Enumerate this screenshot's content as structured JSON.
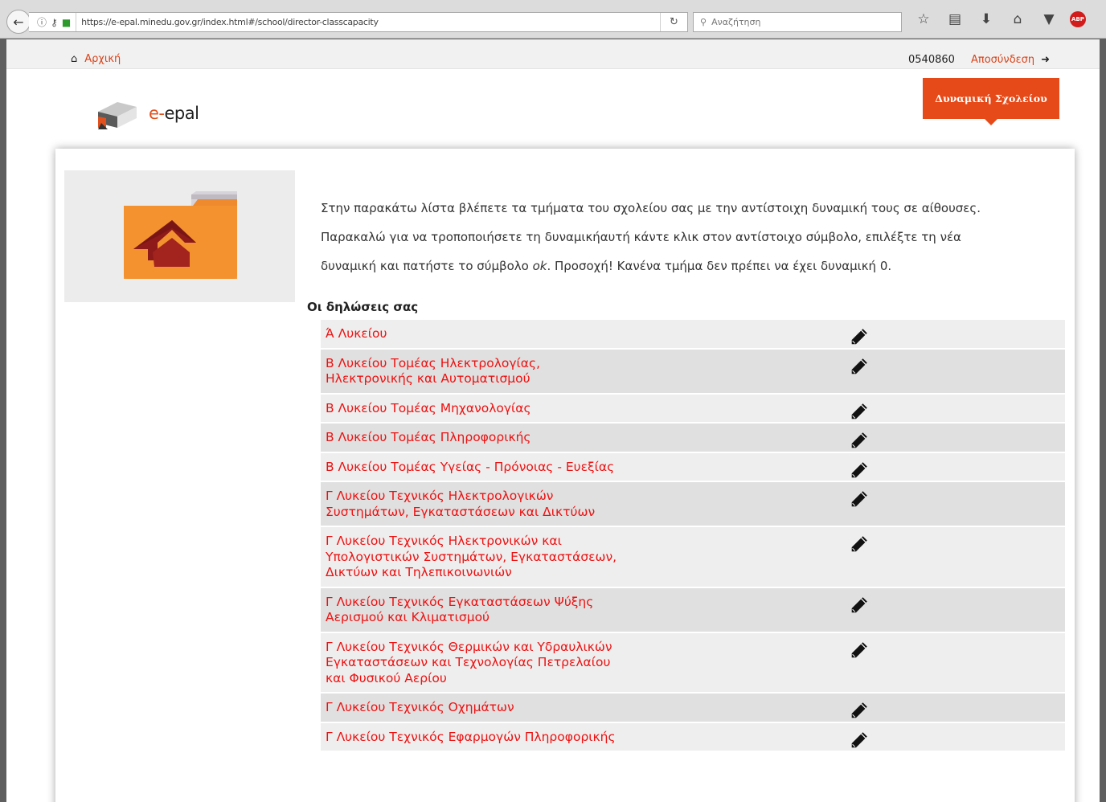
{
  "browser": {
    "url": "https://e-epal.minedu.gov.gr/index.html#/school/director-classcapacity",
    "search_placeholder": "Αναζήτηση"
  },
  "topnav": {
    "home_label": "Αρχική",
    "user_code": "0540860",
    "logout_label": "Αποσύνδεση"
  },
  "logo": {
    "prefix": "e-",
    "name": "epal"
  },
  "school_button": {
    "label": "Δυναμική Σχολείου"
  },
  "intro": {
    "line1": "Στην παρακάτω λίστα βλέπετε τα τμήματα του σχολείου σας με την αντίστοιχη δυναμική τους σε αίθουσες.",
    "line2": "Παρακαλώ για να τροποποιήσετε τη δυναμικήαυτή κάντε κλικ στον αντίστοιχο σύμβολο, επιλέξτε τη νέα",
    "line3_a": "δυναμική και πατήστε το σύμβολο ",
    "line3_ok": "ok",
    "line3_b": ". Προσοχή! Κανένα τμήμα δεν πρέπει να έχει δυναμική 0."
  },
  "list_heading": "Οι δηλώσεις σας",
  "sections": [
    {
      "label": "Ά Λυκείου"
    },
    {
      "label": "Β Λυκείου Τομέας Ηλεκτρολογίας, Ηλεκτρονικής και Αυτοματισμού"
    },
    {
      "label": "Β Λυκείου Τομέας Μηχανολογίας"
    },
    {
      "label": "Β Λυκείου Τομέας Πληροφορικής"
    },
    {
      "label": "Β Λυκείου Τομέας Υγείας - Πρόνοιας - Ευεξίας"
    },
    {
      "label": "Γ Λυκείου Τεχνικός Ηλεκτρολογικών Συστημάτων, Εγκαταστάσεων και Δικτύων"
    },
    {
      "label": "Γ Λυκείου Τεχνικός Ηλεκτρονικών και Υπολογιστικών Συστημάτων, Εγκαταστάσεων, Δικτύων και Τηλεπικοινωνιών"
    },
    {
      "label": "Γ Λυκείου Τεχνικός Εγκαταστάσεων Ψύξης Αερισμού και Κλιματισμού"
    },
    {
      "label": "Γ Λυκείου Τεχνικός Θερμικών και Υδραυλικών Εγκαταστάσεων και Τεχνολογίας Πετρελαίου και Φυσικού Αερίου"
    },
    {
      "label": "Γ Λυκείου Τεχνικός Οχημάτων"
    },
    {
      "label": "Γ Λυκείου Τεχνικός Εφαρμογών Πληροφορικής"
    }
  ],
  "colors": {
    "accent": "#e64a19",
    "link": "#d9431a",
    "section_text": "#ee1111"
  }
}
